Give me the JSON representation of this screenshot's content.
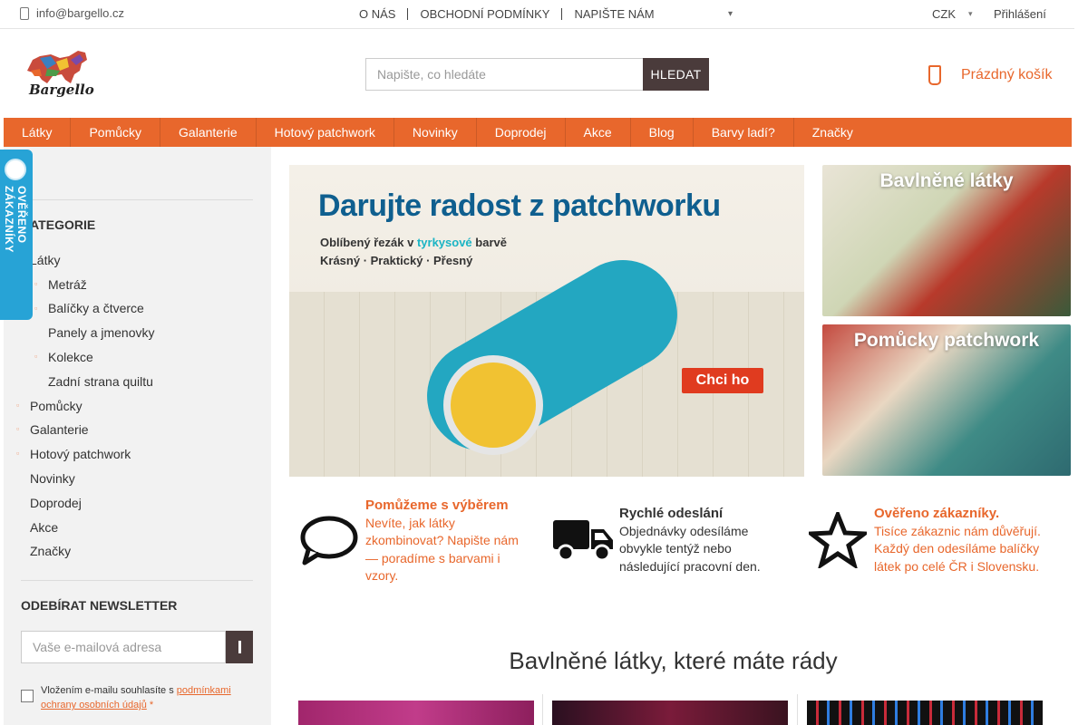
{
  "topbar": {
    "email": "info@bargello.cz",
    "links": [
      "O NÁS",
      "OBCHODNÍ PODMÍNKY",
      "NAPIŠTE NÁM"
    ],
    "currency": "CZK",
    "login": "Přihlášení"
  },
  "logo": {
    "text": "Bargello"
  },
  "search": {
    "placeholder": "Napište, co hledáte",
    "button": "HLEDAT"
  },
  "cart": {
    "label": "Prázdný košík"
  },
  "mainnav": [
    "Látky",
    "Pomůcky",
    "Galanterie",
    "Hotový patchwork",
    "Novinky",
    "Doprodej",
    "Akce",
    "Blog",
    "Barvy ladí?",
    "Značky"
  ],
  "sidebar": {
    "categories_heading": "KATEGORIE",
    "categories": [
      {
        "label": "Látky",
        "level": 0,
        "bullet": false
      },
      {
        "label": "Metráž",
        "level": 1,
        "bullet": true
      },
      {
        "label": "Balíčky a čtverce",
        "level": 1,
        "bullet": true
      },
      {
        "label": "Panely a jmenovky",
        "level": 1,
        "bullet": false
      },
      {
        "label": "Kolekce",
        "level": 1,
        "bullet": true
      },
      {
        "label": "Zadní strana quiltu",
        "level": 1,
        "bullet": false
      },
      {
        "label": "Pomůcky",
        "level": 0,
        "bullet": true
      },
      {
        "label": "Galanterie",
        "level": 0,
        "bullet": true
      },
      {
        "label": "Hotový patchwork",
        "level": 0,
        "bullet": true
      },
      {
        "label": "Novinky",
        "level": 0,
        "bullet": false
      },
      {
        "label": "Doprodej",
        "level": 0,
        "bullet": false
      },
      {
        "label": "Akce",
        "level": 0,
        "bullet": false
      },
      {
        "label": "Značky",
        "level": 0,
        "bullet": false
      }
    ],
    "newsletter_heading": "ODEBÍRAT NEWSLETTER",
    "newsletter_placeholder": "Vaše e-mailová adresa",
    "consent_text": "Vložením e-mailu souhlasíte s",
    "consent_link": "podmínkami ochrany osobních údajů",
    "consent_required": "*"
  },
  "badge": {
    "text": "OVĚŘENO ZÁKAZNÍKY"
  },
  "hero": {
    "headline": "Darujte radost z patchworku",
    "line1_prefix": "Oblíbený řezák v",
    "line1_highlight": "tyrkysové",
    "line1_suffix": "barvě",
    "line2": "Krásný · Praktický · Přesný",
    "cta": "Chci ho"
  },
  "side_banners": [
    "Bavlněné látky",
    "Pomůcky patchwork"
  ],
  "features": [
    {
      "title": "Pomůžeme s výběrem",
      "text": "Nevíte, jak látky zkombinovat? Napište nám — poradíme s barvami i vzory.",
      "icon": "speech-bubble-icon"
    },
    {
      "title": "Rychlé odeslání",
      "text": "Objednávky odesíláme obvykle tentýž nebo následující pracovní den.",
      "icon": "truck-icon"
    },
    {
      "title": "Ověřeno zákazníky.",
      "text": "Tisíce zákaznic nám důvěřují. Každý den odesíláme balíčky látek po celé ČR i Slovensku.",
      "icon": "star-icon"
    }
  ],
  "section": {
    "title": "Bavlněné látky, které máte rády"
  },
  "colors": {
    "accent": "#e8672c",
    "button_dark": "#4a3b3b",
    "badge_blue": "#27a3d6"
  }
}
